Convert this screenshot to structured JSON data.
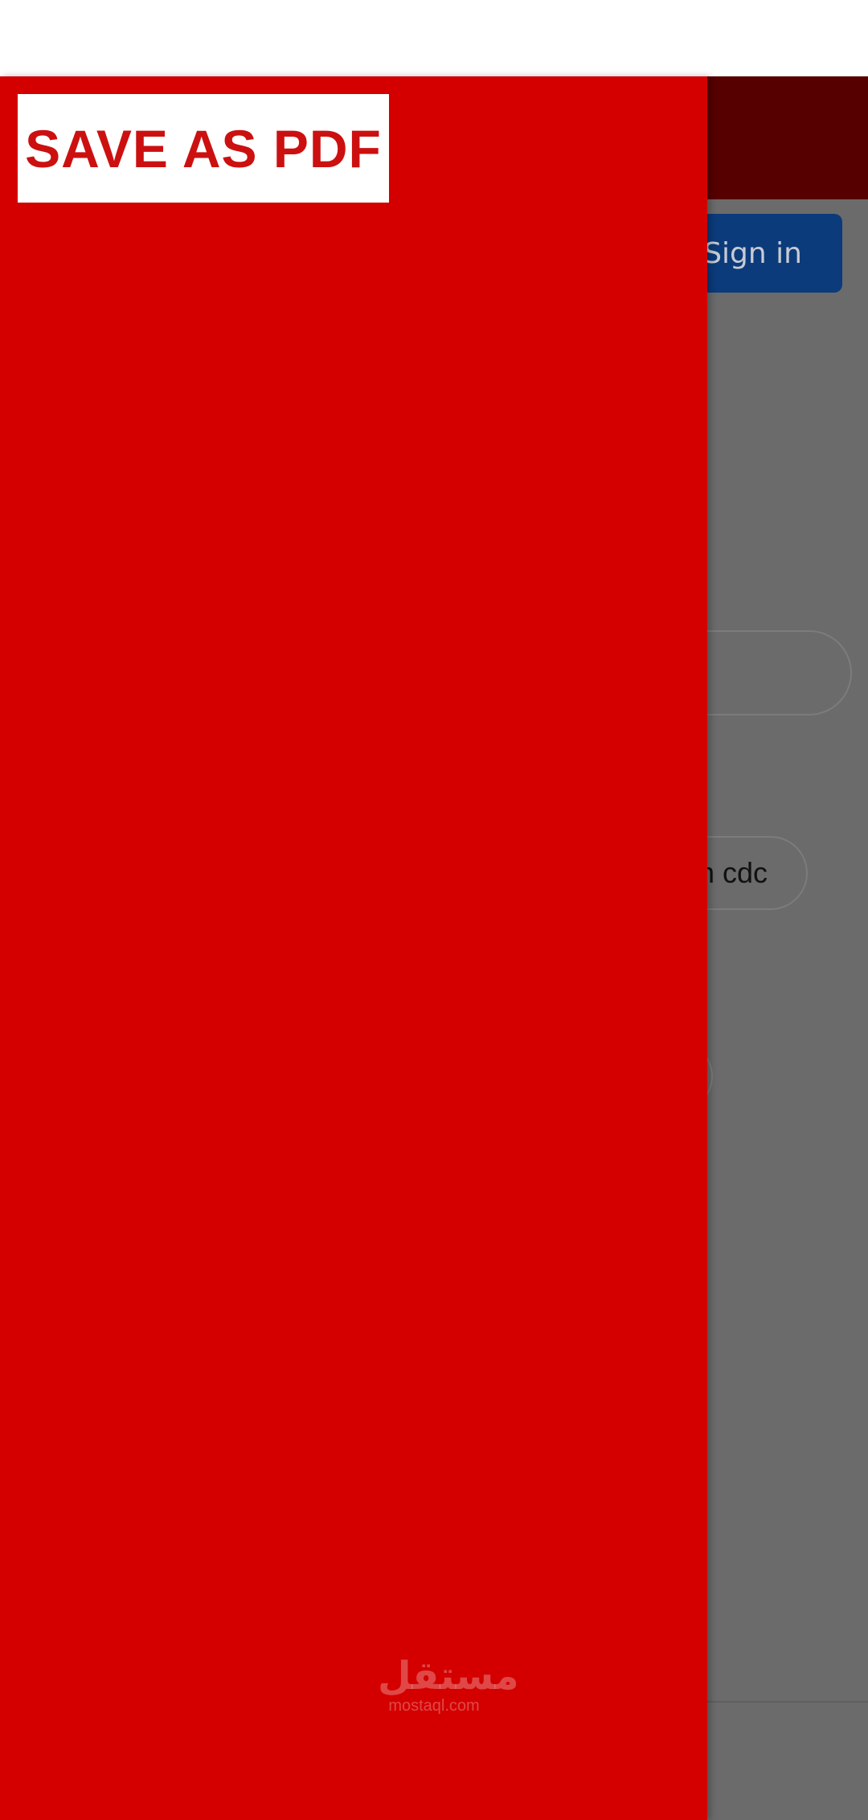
{
  "background_page": {
    "sign_in_label": "Sign in",
    "suggestion_chip_text": "n cdc"
  },
  "drawer": {
    "save_pdf_label": "SAVE AS PDF"
  },
  "watermark": {
    "logo_text": "مستقل",
    "url_text": "mostaql.com"
  },
  "colors": {
    "drawer_background": "#d40000",
    "top_bar_dim": "#560000",
    "sign_in_dim": "#0b3b7b",
    "scrim": "#6b6b6b",
    "save_pdf_text": "#cc1010"
  }
}
